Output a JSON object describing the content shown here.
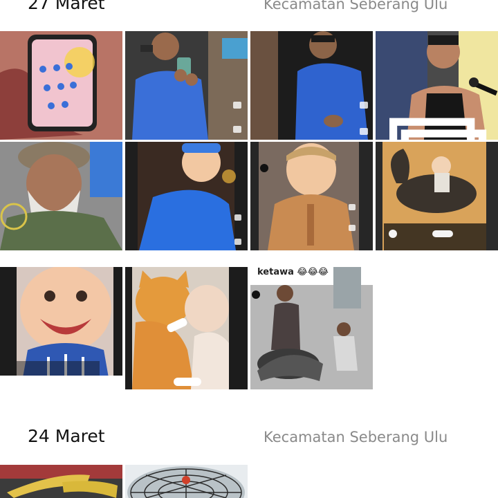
{
  "sections": [
    {
      "date": "27 Maret",
      "location": "Kecamatan Seberang Ulu",
      "photos": [
        {
          "subject": "phone-on-fabric",
          "colors": [
            "#c9877a",
            "#2a2a2a",
            "#f2c9d6"
          ]
        },
        {
          "subject": "man-blue-shirt-phone",
          "colors": [
            "#3a6fd8",
            "#7a5c44",
            "#2c2c2c"
          ]
        },
        {
          "subject": "man-blue-shirt",
          "colors": [
            "#2f63cf",
            "#1b1b1b",
            "#8c6a4f"
          ]
        },
        {
          "subject": "man-black-tank-microphone",
          "colors": [
            "#1a1a1a",
            "#c88e6e",
            "#4b4b4b"
          ]
        },
        {
          "subject": "old-man-beard-turban",
          "colors": [
            "#8e8e8e",
            "#6b4a34",
            "#5b6f4a"
          ]
        },
        {
          "subject": "baby-blue-dress",
          "colors": [
            "#2a6fe0",
            "#c4472a",
            "#1f1f1f"
          ]
        },
        {
          "subject": "baby-brown-cardigan",
          "colors": [
            "#c98b52",
            "#7a6a60",
            "#2a2a2a"
          ]
        },
        {
          "subject": "baby-riding-goose",
          "colors": [
            "#d9a35a",
            "#2b2b2b",
            "#f0efe8"
          ]
        },
        {
          "subject": "smiling-baby",
          "colors": [
            "#f3c7a6",
            "#2f58b3",
            "#1c1c1c"
          ]
        },
        {
          "subject": "cat-and-baby",
          "colors": [
            "#e49a3c",
            "#f0d7c4",
            "#2a2a2a"
          ]
        },
        {
          "subject": "man-scooter-ketawa",
          "colors": [
            "#6b6b6b",
            "#2a2a2a",
            "#b7b7b7"
          ],
          "caption": "ketawa 😂😂😂"
        }
      ]
    },
    {
      "date": "24 Maret",
      "location": "Kecamatan Seberang Ulu",
      "photos": [
        {
          "subject": "bananas",
          "colors": [
            "#e3c24a",
            "#a33a3a",
            "#3b3b3b"
          ]
        },
        {
          "subject": "fan-grille",
          "colors": [
            "#b9c2c7",
            "#2b2b2b",
            "#e8ecef"
          ]
        }
      ]
    }
  ],
  "icons": {
    "multi_photo": "stack-icon"
  }
}
